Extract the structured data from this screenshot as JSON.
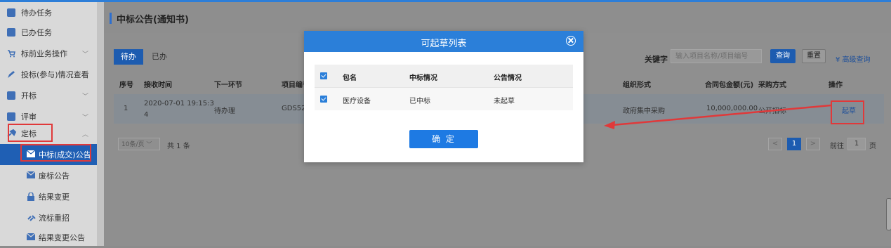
{
  "sidebar": {
    "items": [
      {
        "label": "待办任务"
      },
      {
        "label": "已办任务"
      },
      {
        "label": "标前业务操作"
      },
      {
        "label": "投标(参与)情况查看"
      },
      {
        "label": "开标"
      },
      {
        "label": "评审"
      },
      {
        "label": "定标"
      },
      {
        "label": "中标(成交)公告"
      },
      {
        "label": "废标公告"
      },
      {
        "label": "结果变更"
      },
      {
        "label": "流标重招"
      },
      {
        "label": "结果变更公告"
      }
    ]
  },
  "page": {
    "title": "中标公告(通知书)"
  },
  "tabs": [
    {
      "label": "待办"
    },
    {
      "label": "已办"
    }
  ],
  "search": {
    "keyword_label": "关键字",
    "placeholder": "输入项目名称/项目编号",
    "query_label": "查询",
    "reset_label": "重置",
    "advanced_label": "高级查询"
  },
  "table": {
    "headers": [
      "序号",
      "接收时间",
      "下一环节",
      "项目编号",
      "组织形式",
      "合同包金额(元)",
      "采购方式",
      "操作"
    ],
    "rows": [
      {
        "index": "1",
        "time_line1": "2020-07-01 19:15:3",
        "time_line2": "4",
        "next_step": "待办理",
        "project_no": "GDS52",
        "org_form": "政府集中采购",
        "amount": "10,000,000.00",
        "method": "公开招标",
        "action": "起草"
      }
    ]
  },
  "pagination": {
    "page_size": "10条/页",
    "total": "共 1 条",
    "prev": "<",
    "current": "1",
    "next": ">",
    "goto_label": "前往",
    "goto_value": "1",
    "page_suffix": "页"
  },
  "modal": {
    "title": "可起草列表",
    "headers": [
      "包名",
      "中标情况",
      "公告情况"
    ],
    "rows": [
      {
        "package": "医疗设备",
        "status": "已中标",
        "notice": "未起草"
      }
    ],
    "confirm_label": "确 定"
  },
  "colors": {
    "accent": "#2b7fd9",
    "annotation": "#e0393a"
  }
}
